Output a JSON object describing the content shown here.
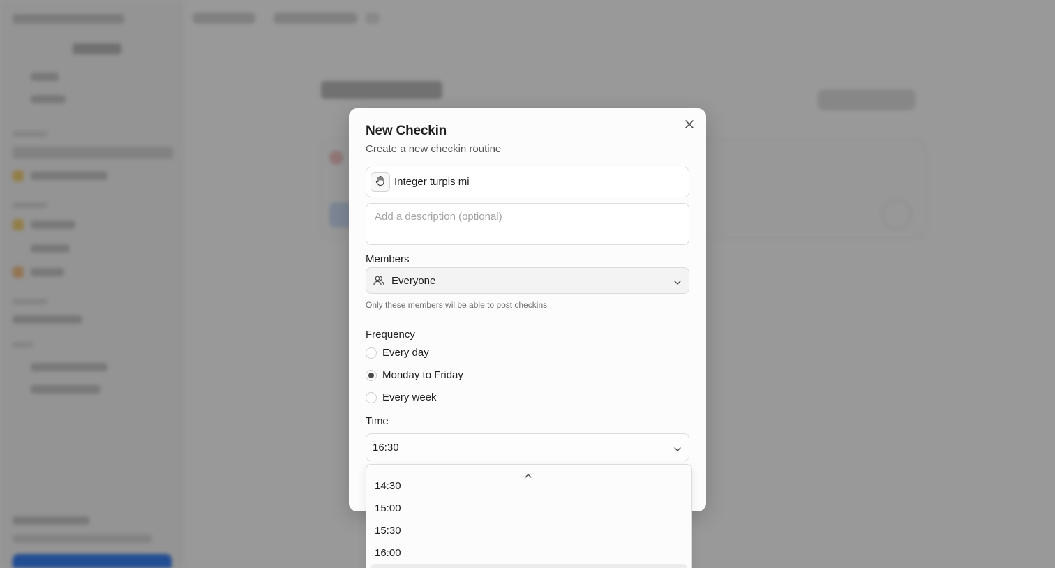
{
  "dialog": {
    "title": "New Checkin",
    "subtitle": "Create a new checkin routine",
    "close_icon": "close-icon",
    "name_icon": "hand-icon",
    "name_value": "Integer turpis mi",
    "description_placeholder": "Add a description (optional)"
  },
  "members": {
    "label": "Members",
    "icon": "users-icon",
    "value": "Everyone",
    "hint": "Only these members wil be able to post checkins"
  },
  "frequency": {
    "label": "Frequency",
    "options": [
      {
        "label": "Every day",
        "checked": false
      },
      {
        "label": "Monday to Friday",
        "checked": true
      },
      {
        "label": "Every week",
        "checked": false
      }
    ]
  },
  "time": {
    "label": "Time",
    "value": "16:30",
    "options": [
      "14:30",
      "15:00",
      "15:30",
      "16:00"
    ]
  },
  "colors": {
    "overlay": "rgba(0,0,0,0.40)",
    "dialog_bg": "#fcfcfc",
    "select_bg": "#f3f3f3",
    "accent_blue": "#3b82f6"
  }
}
